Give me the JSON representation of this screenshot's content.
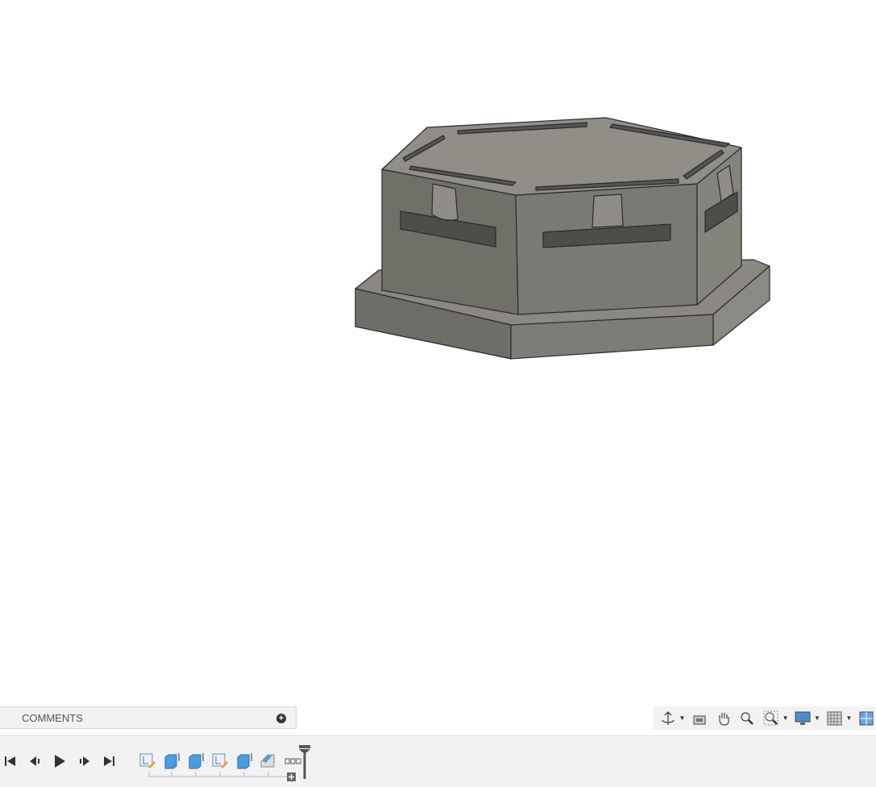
{
  "comments_panel": {
    "label": "COMMENTS",
    "add_icon": "plus-circle-icon"
  },
  "nav_toolbar": {
    "icons": [
      "orbit-icon",
      "look-at-icon",
      "pan-icon",
      "zoom-icon",
      "zoom-window-icon",
      "display-settings-icon",
      "grid-settings-icon",
      "viewports-icon"
    ]
  },
  "timeline": {
    "playback": [
      "go-to-start-icon",
      "step-back-icon",
      "play-icon",
      "step-forward-icon",
      "go-to-end-icon"
    ],
    "features": [
      "sketch-icon",
      "extrude-icon",
      "extrude-icon",
      "sketch-icon",
      "extrude-icon",
      "fillet-icon"
    ]
  },
  "colors": {
    "model_face": "#7a7a74",
    "model_top": "#8f8d85",
    "feature_blue": "#4a9ee0",
    "panel_bg": "#f2f2f2"
  }
}
